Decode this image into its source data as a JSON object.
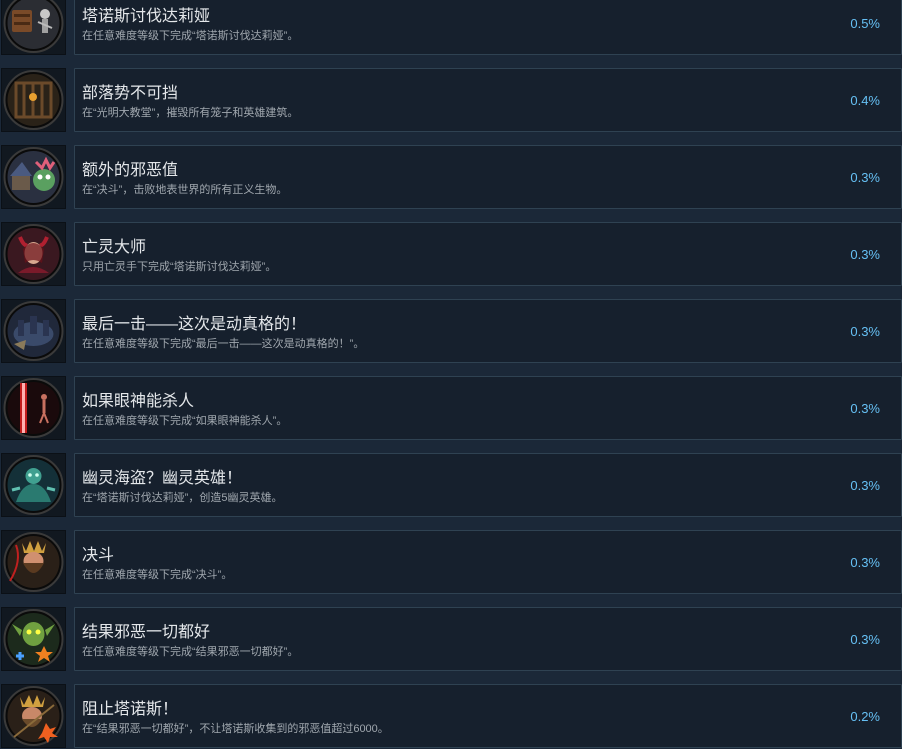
{
  "achievements": [
    {
      "title": "塔诺斯讨伐达莉娅",
      "description": "在任意难度等级下完成“塔诺斯讨伐达莉娅”。",
      "percent": "0.5%",
      "icon": "cart-and-skeleton-icon"
    },
    {
      "title": "部落势不可挡",
      "description": "在“光明大教堂”，摧毁所有笼子和英雄建筑。",
      "percent": "0.4%",
      "icon": "cage-icon"
    },
    {
      "title": "额外的邪恶值",
      "description": "在“决斗”，击败地表世界的所有正义生物。",
      "percent": "0.3%",
      "icon": "house-and-creature-icon"
    },
    {
      "title": "亡灵大师",
      "description": "只用亡灵手下完成“塔诺斯讨伐达莉娅”。",
      "percent": "0.3%",
      "icon": "horned-woman-icon"
    },
    {
      "title": "最后一击——这次是动真格的！",
      "description": "在任意难度等级下完成“最后一击——这次是动真格的！”。",
      "percent": "0.3%",
      "icon": "dark-fortress-icon"
    },
    {
      "title": "如果眼神能杀人",
      "description": "在任意难度等级下完成“如果眼神能杀人”。",
      "percent": "0.3%",
      "icon": "laser-beam-icon"
    },
    {
      "title": "幽灵海盗？幽灵英雄！",
      "description": "在“塔诺斯讨伐达莉娅”，创造5幽灵英雄。",
      "percent": "0.3%",
      "icon": "ghost-warrior-icon"
    },
    {
      "title": "决斗",
      "description": "在任意难度等级下完成“决斗”。",
      "percent": "0.3%",
      "icon": "bearded-warrior-icon"
    },
    {
      "title": "结果邪恶一切都好",
      "description": "在任意难度等级下完成“结果邪恶一切都好”。",
      "percent": "0.3%",
      "icon": "goblin-star-icon"
    },
    {
      "title": "阻止塔诺斯！",
      "description": "在“结果邪恶一切都好”，不让塔诺斯收集到的邪恶值超过6000。",
      "percent": "0.2%",
      "icon": "king-explosion-icon"
    }
  ]
}
